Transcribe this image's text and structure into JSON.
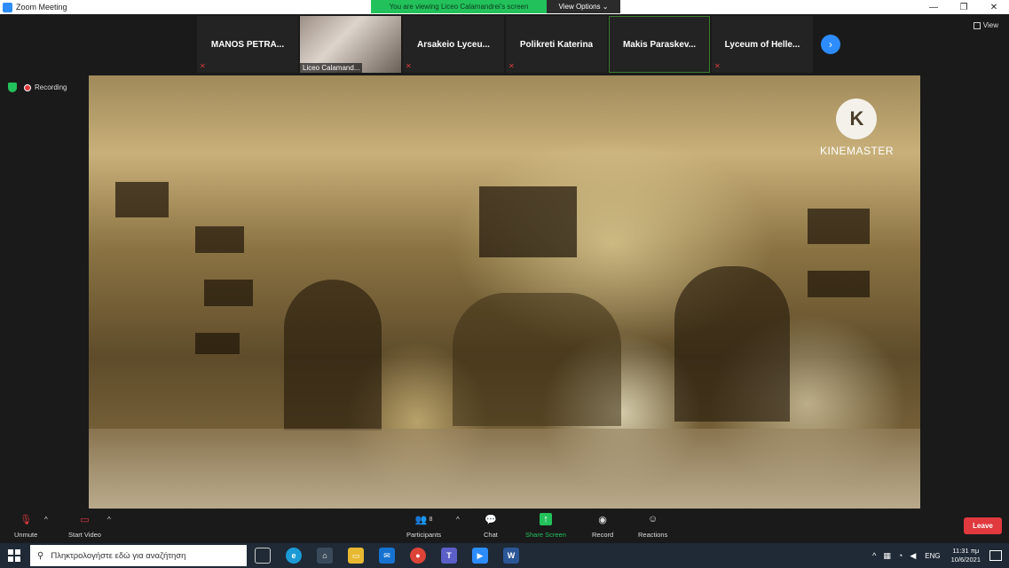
{
  "window": {
    "title": "Zoom Meeting",
    "minimize": "—",
    "restore": "❐",
    "close": "✕"
  },
  "banner": {
    "viewing": "You are viewing Liceo Calamandrei's screen",
    "view_options": "View Options ⌄"
  },
  "view_toggle": "View",
  "participants": [
    {
      "name": "MANOS PETRA...",
      "muted": true
    },
    {
      "name": "Liceo Calamand...",
      "video": true
    },
    {
      "name": "Arsakeio Lyceu...",
      "muted": true
    },
    {
      "name": "Polikreti Katerina",
      "muted": true
    },
    {
      "name": "Makis Paraskev...",
      "active": true
    },
    {
      "name": "Lyceum of Helle...",
      "muted": true
    }
  ],
  "next_arrow": "›",
  "status": {
    "recording": "Recording"
  },
  "share": {
    "logo_letter": "K",
    "logo_text": "KINEMASTER"
  },
  "toolbar": {
    "unmute": "Unmute",
    "start_video": "Start Video",
    "participants": "Participants",
    "participants_count": "8",
    "chat": "Chat",
    "share_screen": "Share Screen",
    "record": "Record",
    "reactions": "Reactions",
    "leave": "Leave"
  },
  "taskbar": {
    "search_placeholder": "Πληκτρολογήστε εδώ για αναζήτηση",
    "language": "ENG",
    "time": "11:31 πμ",
    "date": "10/6/2021"
  },
  "colors": {
    "accent": "#2d8cff",
    "green": "#23c15b",
    "leave": "#e0393e"
  }
}
